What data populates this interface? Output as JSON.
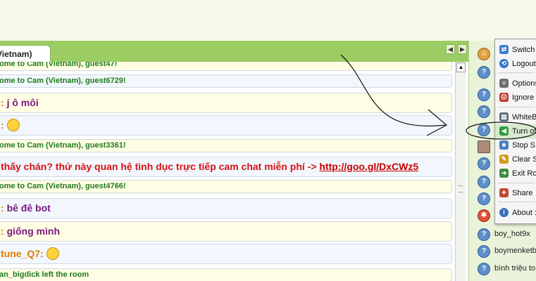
{
  "room_tab": {
    "label": "Vietnam)"
  },
  "chat": {
    "messages": [
      {
        "kind": "system",
        "text": "ome to Cam (Vietnam), guest47!"
      },
      {
        "kind": "system",
        "text": "ome to Cam (Vietnam), guest6729!"
      },
      {
        "kind": "user",
        "text": "j ô môi"
      },
      {
        "kind": "emoji",
        "text": "😁"
      },
      {
        "kind": "system",
        "text": "ome to Cam (Vietnam), guest3361!"
      },
      {
        "kind": "spam",
        "text": "thấy chán? thử này quan hệ tình dục trực tiếp cam chat miễn phí ->",
        "link": "http://goo.gl/DxCWz5"
      },
      {
        "kind": "system",
        "text": "ome to Cam (Vietnam), guest4766!"
      },
      {
        "kind": "user",
        "text": "bê đê bot"
      },
      {
        "kind": "user",
        "text": "giống mình"
      },
      {
        "kind": "nick",
        "text": "tune_Q7:"
      },
      {
        "kind": "system",
        "text": "an_bigdick left the room"
      }
    ],
    "colon": ":"
  },
  "menu": {
    "items": [
      {
        "label": "Switch",
        "icon": "switch-icon",
        "color": "#3a7bd5"
      },
      {
        "label": "Logout",
        "icon": "logout-icon",
        "color": "#2f74c9"
      },
      {
        "label": "Options",
        "icon": "options-icon",
        "color": "#6e6e6e"
      },
      {
        "label": "Ignore",
        "icon": "ignore-icon",
        "color": "#c0392b"
      },
      {
        "label": "WhiteB",
        "icon": "whiteboard-icon",
        "color": "#5a6b7a"
      },
      {
        "label": "Turn of",
        "icon": "sound-icon",
        "color": "#2e9b3c"
      },
      {
        "label": "Stop S",
        "icon": "stop-icon",
        "color": "#4a7fc0"
      },
      {
        "label": "Clear S",
        "icon": "broom-icon",
        "color": "#d19a1e"
      },
      {
        "label": "Exit Ro",
        "icon": "exit-icon",
        "color": "#3c8d3c"
      },
      {
        "label": "Share",
        "icon": "share-icon",
        "color": "#c2472e"
      },
      {
        "label": "About :",
        "icon": "about-icon",
        "color": "#3b6fb6"
      }
    ]
  },
  "users": {
    "items": [
      {
        "name": "boy_hot9x"
      },
      {
        "name": "boymenketb"
      },
      {
        "name": "bình triệu to"
      }
    ]
  }
}
